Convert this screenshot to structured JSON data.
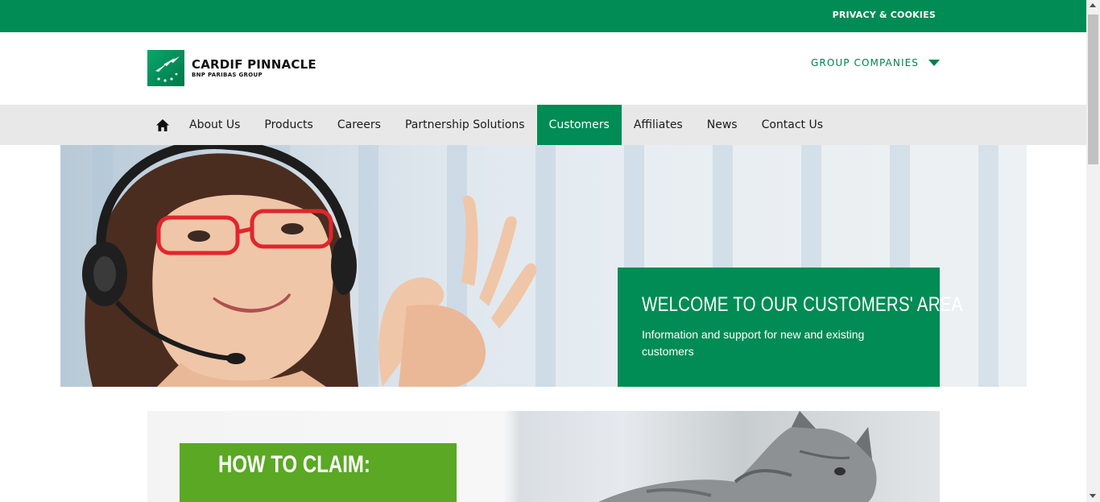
{
  "topbar": {
    "privacy_label": "PRIVACY & COOKIES"
  },
  "header": {
    "logo_name": "CARDIF PINNACLE",
    "logo_sub": "BNP PARIBAS GROUP",
    "group_companies_label": "GROUP COMPANIES"
  },
  "nav": {
    "home_icon": "home-icon",
    "items": [
      {
        "label": "About Us",
        "active": false
      },
      {
        "label": "Products",
        "active": false
      },
      {
        "label": "Careers",
        "active": false
      },
      {
        "label": "Partnership Solutions",
        "active": false
      },
      {
        "label": "Customers",
        "active": true
      },
      {
        "label": "Affiliates",
        "active": false
      },
      {
        "label": "News",
        "active": false
      },
      {
        "label": "Contact Us",
        "active": false
      }
    ]
  },
  "hero": {
    "title": "WELCOME TO OUR CUSTOMERS' AREA",
    "subtitle": "Information and support for new and existing customers"
  },
  "claim": {
    "title": "HOW TO CLAIM:"
  },
  "colors": {
    "brand_green": "#008c54",
    "claim_green": "#5aa823",
    "nav_bg": "#e8e8e8"
  }
}
